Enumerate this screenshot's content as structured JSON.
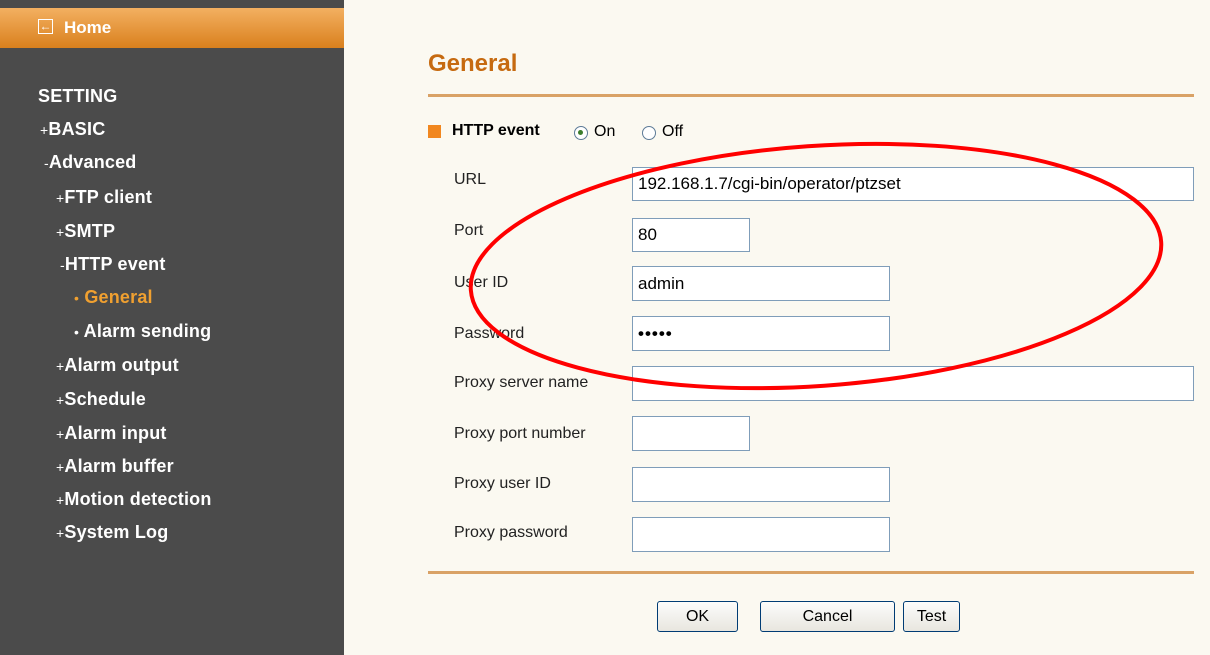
{
  "sidebar": {
    "home_label": "Home",
    "items": [
      {
        "prefix": "",
        "label": "SETTING"
      },
      {
        "prefix": "+",
        "label": "BASIC"
      },
      {
        "prefix": "-",
        "label": "Advanced"
      },
      {
        "prefix": "+",
        "label": "FTP client"
      },
      {
        "prefix": "+",
        "label": "SMTP"
      },
      {
        "prefix": "-",
        "label": "HTTP event"
      },
      {
        "prefix": "•",
        "label": "General"
      },
      {
        "prefix": "•",
        "label": "Alarm sending"
      },
      {
        "prefix": "+",
        "label": "Alarm output"
      },
      {
        "prefix": "+",
        "label": "Schedule"
      },
      {
        "prefix": "+",
        "label": "Alarm input"
      },
      {
        "prefix": "+",
        "label": "Alarm buffer"
      },
      {
        "prefix": "+",
        "label": "Motion detection"
      },
      {
        "prefix": "+",
        "label": "System Log"
      }
    ]
  },
  "main": {
    "title": "General",
    "http_event": {
      "label": "HTTP event",
      "on_label": "On",
      "off_label": "Off",
      "selected": "On"
    },
    "fields": {
      "url": {
        "label": "URL",
        "value": "192.168.1.7/cgi-bin/operator/ptzset"
      },
      "port": {
        "label": "Port",
        "value": "80"
      },
      "user_id": {
        "label": "User ID",
        "value": "admin"
      },
      "password": {
        "label": "Password",
        "value": "•••••"
      },
      "proxy_server_name": {
        "label": "Proxy server name",
        "value": ""
      },
      "proxy_port_number": {
        "label": "Proxy port number",
        "value": ""
      },
      "proxy_user_id": {
        "label": "Proxy user ID",
        "value": ""
      },
      "proxy_password": {
        "label": "Proxy password",
        "value": ""
      }
    },
    "buttons": {
      "ok": "OK",
      "cancel": "Cancel",
      "test": "Test"
    }
  },
  "colors": {
    "accent": "#d9801d",
    "sidebar_bg": "#4b4b4b",
    "title": "#c66a10",
    "annotation": "#ff0000"
  }
}
